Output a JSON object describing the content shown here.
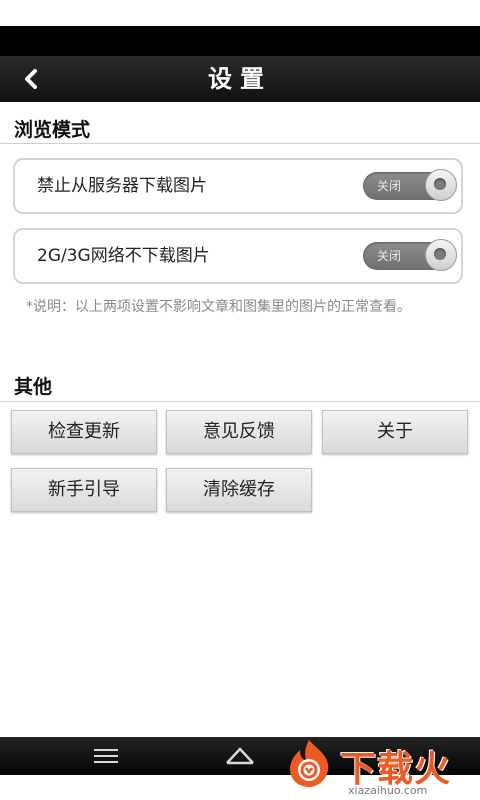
{
  "header": {
    "title": "设置",
    "back_icon": "chevron-left-icon"
  },
  "browse_section": {
    "title": "浏览模式",
    "settings": [
      {
        "label": "禁止从服务器下载图片",
        "toggle_label": "关闭",
        "enabled": false
      },
      {
        "label": "2G/3G网络不下载图片",
        "toggle_label": "关闭",
        "enabled": false
      }
    ],
    "note": "*说明：以上两项设置不影响文章和图集里的图片的正常查看。"
  },
  "other_section": {
    "title": "其他",
    "buttons": [
      "检查更新",
      "意见反馈",
      "关于",
      "新手引导",
      "清除缓存"
    ]
  },
  "nav_bar": {
    "icons": [
      "menu-icon",
      "home-icon"
    ]
  },
  "watermark": {
    "brand": "下载火",
    "url": "xiazaihuo.com"
  },
  "colors": {
    "title_bar": "#1a1a1a",
    "toggle_off": "#7a7a7a",
    "watermark_accent": "#ef5a24"
  }
}
